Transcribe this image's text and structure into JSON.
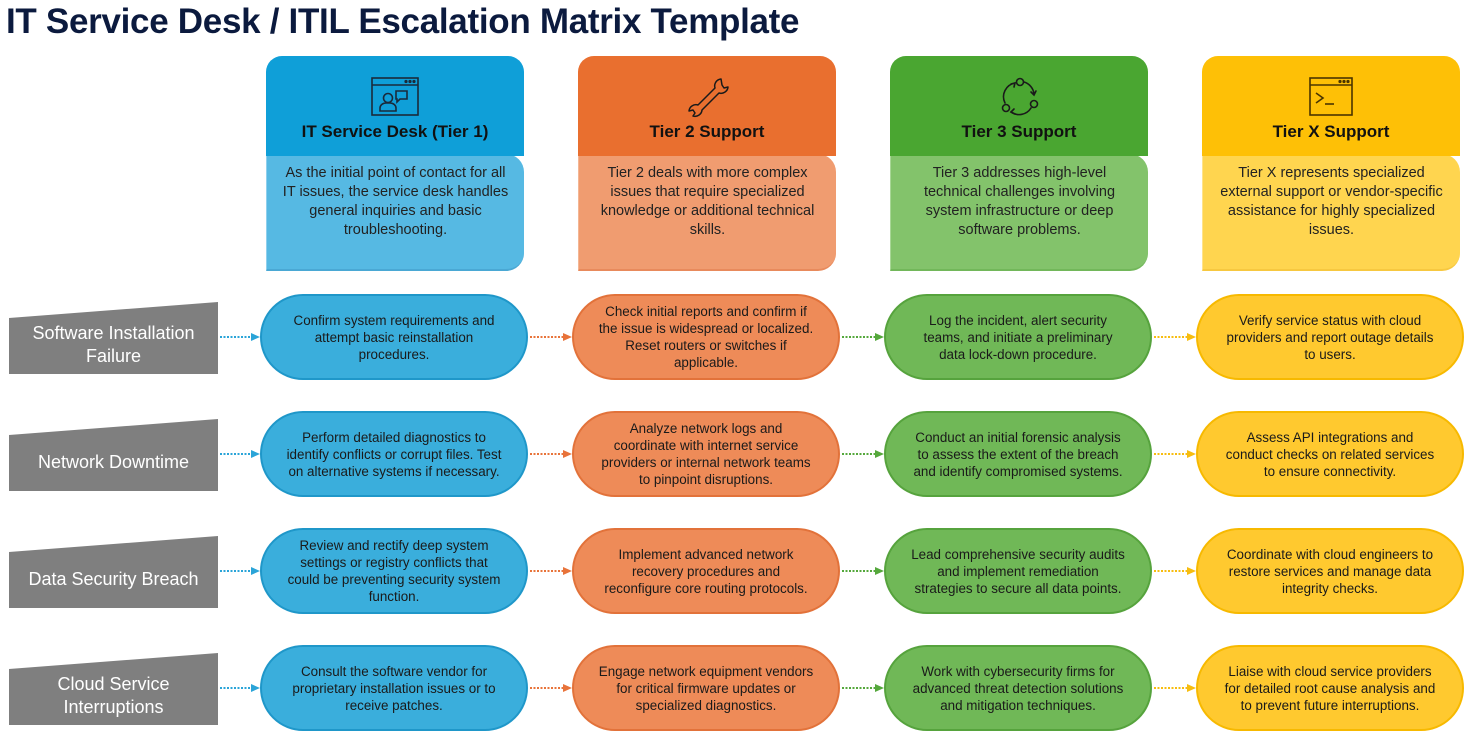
{
  "title": "IT Service Desk / ITIL Escalation Matrix Template",
  "colors": {
    "tier1": "#0f9fd8",
    "tier2": "#e96f2f",
    "tier3": "#4aa631",
    "tierx": "#fec006",
    "row_label_bg": "#7f7f7f",
    "title_text": "#0b1a3e"
  },
  "tiers": [
    {
      "title": "IT Service Desk (Tier 1)",
      "icon": "user-chat-window-icon",
      "description": "As the initial point of contact for all IT issues, the service desk handles general inquiries and basic troubleshooting."
    },
    {
      "title": "Tier 2 Support",
      "icon": "wrench-icon",
      "description": "Tier 2 deals with more complex issues that require specialized knowledge or additional technical skills."
    },
    {
      "title": "Tier 3 Support",
      "icon": "cycle-arrows-icon",
      "description": "Tier 3 addresses high-level technical challenges involving system infrastructure or deep software problems."
    },
    {
      "title": "Tier X Support",
      "icon": "terminal-window-icon",
      "description": "Tier X represents specialized external support or vendor-specific assistance for highly specialized issues."
    }
  ],
  "rows": [
    {
      "label": "Software Installation Failure",
      "cells": [
        "Confirm system requirements and attempt basic reinstallation procedures.",
        "Check initial reports and confirm if the issue is widespread or localized. Reset routers or switches if applicable.",
        "Log the incident, alert security teams, and initiate a preliminary data lock-down procedure.",
        "Verify service status with cloud providers and report outage details to users."
      ]
    },
    {
      "label": "Network Downtime",
      "cells": [
        "Perform detailed diagnostics to identify conflicts or corrupt files. Test on alternative systems if necessary.",
        "Analyze network logs and coordinate with internet service providers or internal network teams to pinpoint disruptions.",
        "Conduct an initial forensic analysis to assess the extent of the breach and identify compromised systems.",
        "Assess API integrations and conduct checks on related services to ensure connectivity."
      ]
    },
    {
      "label": "Data Security Breach",
      "cells": [
        "Review and rectify deep system settings or registry conflicts that could be preventing security system function.",
        "Implement advanced network recovery procedures and reconfigure core routing protocols.",
        "Lead comprehensive security audits and implement remediation strategies to secure all data points.",
        "Coordinate with cloud engineers to restore services and manage data integrity checks."
      ]
    },
    {
      "label": "Cloud Service Interruptions",
      "cells": [
        "Consult the software vendor for proprietary installation issues or to receive patches.",
        "Engage network equipment vendors for critical firmware updates or specialized diagnostics.",
        "Work with cybersecurity firms for advanced threat detection solutions and mitigation techniques.",
        "Liaise with cloud service providers for detailed root cause analysis and to prevent future interruptions."
      ]
    }
  ]
}
